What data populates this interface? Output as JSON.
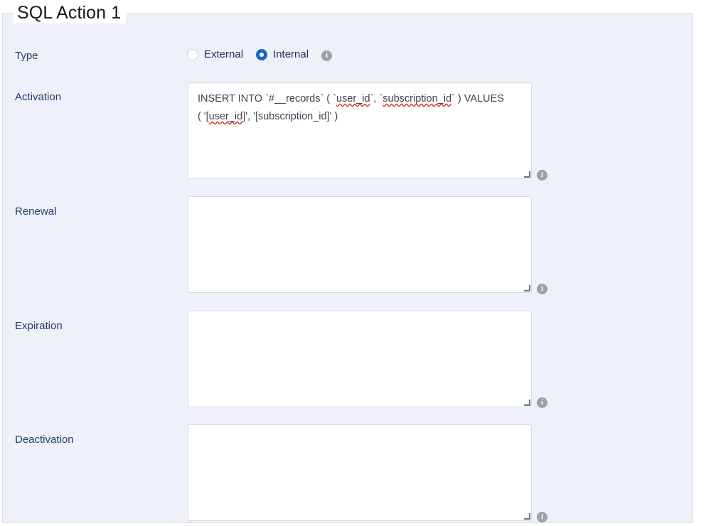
{
  "panel": {
    "legend": "SQL Action 1"
  },
  "type_field": {
    "label": "Type",
    "options": [
      {
        "label": "External",
        "checked": false
      },
      {
        "label": "Internal",
        "checked": true
      }
    ],
    "info_icon": "info-icon"
  },
  "fields": [
    {
      "label": "Activation",
      "value": "INSERT INTO `#__records` ( `user_id`, `subscription_id` ) VALUES ( '[user_id]', '[subscription_id]' )",
      "line1_prefix": "INSERT INTO `#__records` ( `",
      "line1_sp1": "user_id",
      "line1_mid": "`, `",
      "line1_sp2": "subscription_id",
      "line1_suffix": "` ) VALUES",
      "line2_prefix": "( '[",
      "line2_sp1": "user_id",
      "line2_suffix": "]', '[subscription_id]' )",
      "info_icon": "info-icon"
    },
    {
      "label": "Renewal",
      "value": "",
      "info_icon": "info-icon"
    },
    {
      "label": "Expiration",
      "value": "",
      "info_icon": "info-icon"
    },
    {
      "label": "Deactivation",
      "value": "",
      "info_icon": "info-icon"
    }
  ],
  "colors": {
    "panel_bg": "#eef1fa",
    "panel_border": "#dcdfe8",
    "label_text": "#243a6b",
    "legend_text": "#16181d",
    "radio_accent": "#1767c4",
    "input_bg": "#ffffff",
    "input_border": "#d7dae1",
    "input_text": "#3c4350",
    "info_icon_bg": "#9ba0ac",
    "spellcheck_underline": "#e03131"
  }
}
